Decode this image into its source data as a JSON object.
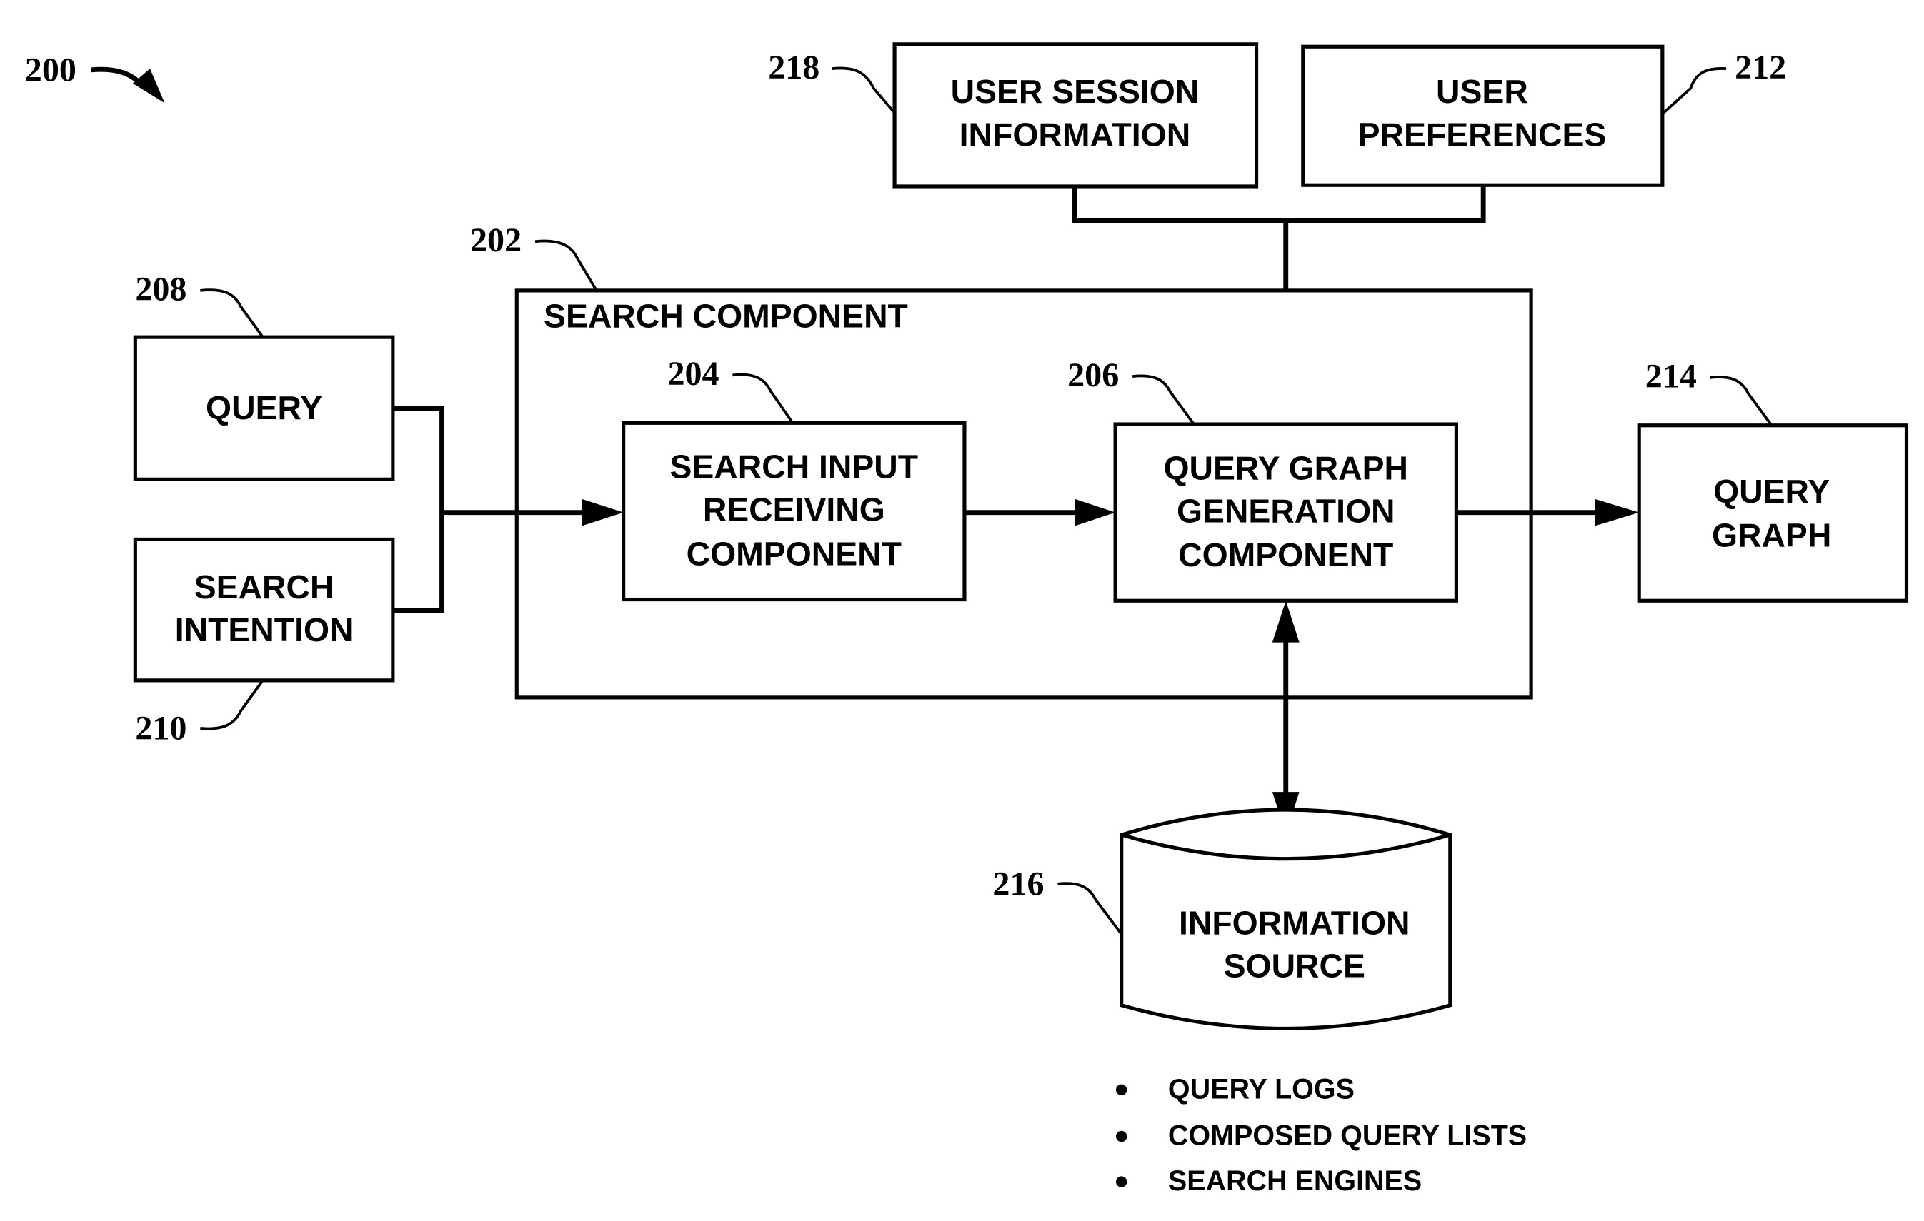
{
  "figure_ref": "200",
  "search_component": {
    "ref": "202",
    "label": "SEARCH COMPONENT"
  },
  "search_input": {
    "ref": "204",
    "lines": [
      "SEARCH INPUT",
      "RECEIVING",
      "COMPONENT"
    ]
  },
  "query_graph_gen": {
    "ref": "206",
    "lines": [
      "QUERY GRAPH",
      "GENERATION",
      "COMPONENT"
    ]
  },
  "query": {
    "ref": "208",
    "lines": [
      "QUERY"
    ]
  },
  "search_intention": {
    "ref": "210",
    "lines": [
      "SEARCH",
      "INTENTION"
    ]
  },
  "user_preferences": {
    "ref": "212",
    "lines": [
      "USER",
      "PREFERENCES"
    ]
  },
  "query_graph": {
    "ref": "214",
    "lines": [
      "QUERY",
      "GRAPH"
    ]
  },
  "information_source": {
    "ref": "216",
    "lines": [
      "INFORMATION",
      "SOURCE"
    ],
    "items": [
      "QUERY LOGS",
      "COMPOSED QUERY LISTS",
      "SEARCH ENGINES"
    ]
  },
  "user_session": {
    "ref": "218",
    "lines": [
      "USER SESSION",
      "INFORMATION"
    ]
  }
}
